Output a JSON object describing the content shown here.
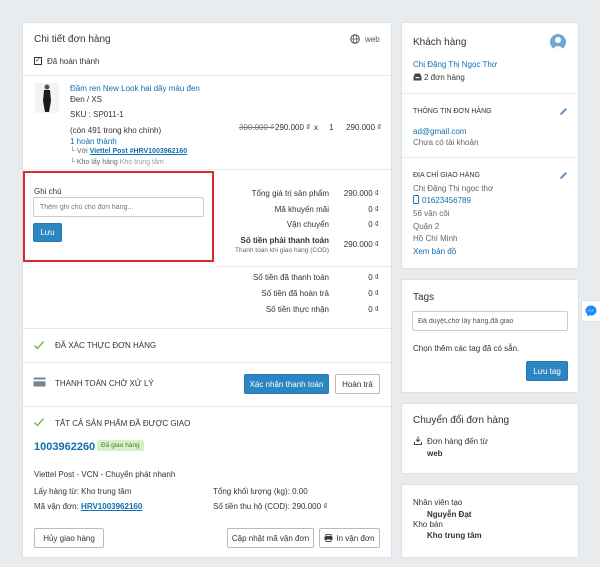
{
  "order": {
    "title": "Chi tiết đơn hàng",
    "source": "web",
    "status": "Đã hoàn thành",
    "product": {
      "name": "Đầm ren New Look hai dây màu đen",
      "variant": "Đen / XS",
      "sku": "SKU : SP011-1",
      "stock": "(còn 491 trong kho chính)",
      "fulfilled": "1 hoàn thành",
      "carrier_prefix": "Với ",
      "carrier_link": "Viettel Post #HRV1003962160",
      "warehouse_prefix": "Kho lấy hàng ",
      "warehouse": "Kho trung tâm",
      "old_price": "300.000 ₫",
      "price": "290.000 ₫",
      "times": "x",
      "qty": "1",
      "line_total": "290.000 ₫"
    },
    "note": {
      "label": "Ghi chú",
      "placeholder": "Thêm ghi chú cho đơn hàng...",
      "save": "Lưu"
    },
    "summary": [
      {
        "label": "Tổng giá trị sản phẩm",
        "value": "290.000 ₫"
      },
      {
        "label": "Mã khuyến mãi",
        "value": "0 ₫"
      },
      {
        "label": "Vận chuyển",
        "value": "0 ₫"
      }
    ],
    "total": {
      "label": "Số tiền phải thanh toán",
      "sub": "Thanh toán khi giao hàng (COD)",
      "value": "290.000 ₫"
    },
    "payments": [
      {
        "label": "Số tiền đã thanh toán",
        "value": "0 ₫"
      },
      {
        "label": "Số tiền đã hoàn trả",
        "value": "0 ₫"
      },
      {
        "label": "Số tiền thực nhận",
        "value": "0 ₫"
      }
    ],
    "verified": "ĐÃ XÁC THỰC ĐƠN HÀNG",
    "payment_status": "THANH TOÁN CHỜ XỬ LÝ",
    "confirm_payment": "Xác nhận thanh toán",
    "refund": "Hoàn trả",
    "delivered": "TẤT CẢ SẢN PHẨM ĐÃ ĐƯỢC GIAO",
    "shipment": {
      "code": "1003962260",
      "badge": "Đã giao hàng",
      "carrier": "Viettel Post - VCN - Chuyển phát nhanh",
      "pickup": "Lấy hàng từ: Kho trung tâm",
      "weight": "Tổng khối lượng (kg): 0.00",
      "tracking_prefix": "Mã vận đơn: ",
      "tracking": "HRV1003962160",
      "cod": "Số tiền thu hộ (COD): 290.000 ₫",
      "cancel": "Hủy giao hàng",
      "update": "Cập nhật mã vận đơn",
      "print": "In vận đơn"
    }
  },
  "customer": {
    "title": "Khách hàng",
    "name": "Chị Đặng Thị Ngọc Thơ",
    "orders": "2 đơn hàng",
    "info_title": "THÔNG TIN ĐƠN HÀNG",
    "email": "ad@gmail.com",
    "account": "Chưa có tài khoản",
    "ship_title": "ĐỊA CHỈ GIAO HÀNG",
    "ship_name": "Chị Đặng Thị ngọc thơ",
    "phone": "01623456789",
    "address": "56 vân côi",
    "district": "Quận 2",
    "city": "Hồ Chí Minh",
    "map": "Xem bản đồ"
  },
  "tags": {
    "title": "Tags",
    "value": "Đã duyệt,chờ lấy hàng,đã giao",
    "hint": "Chọn thêm các tag đã có sẵn.",
    "save": "Lưu tag"
  },
  "conversion": {
    "title": "Chuyển đổi đơn hàng",
    "label": "Đơn hàng đến từ",
    "source": "web"
  },
  "staff": {
    "creator_label": "Nhân viên tạo",
    "creator": "Nguyễn Đạt",
    "store_label": "Kho bán",
    "store": "Kho trung tâm"
  },
  "colors": {
    "accent": "#2b86c2",
    "link": "#0f6fb0",
    "note_border": "#d9282f",
    "check": "#7cb342"
  }
}
